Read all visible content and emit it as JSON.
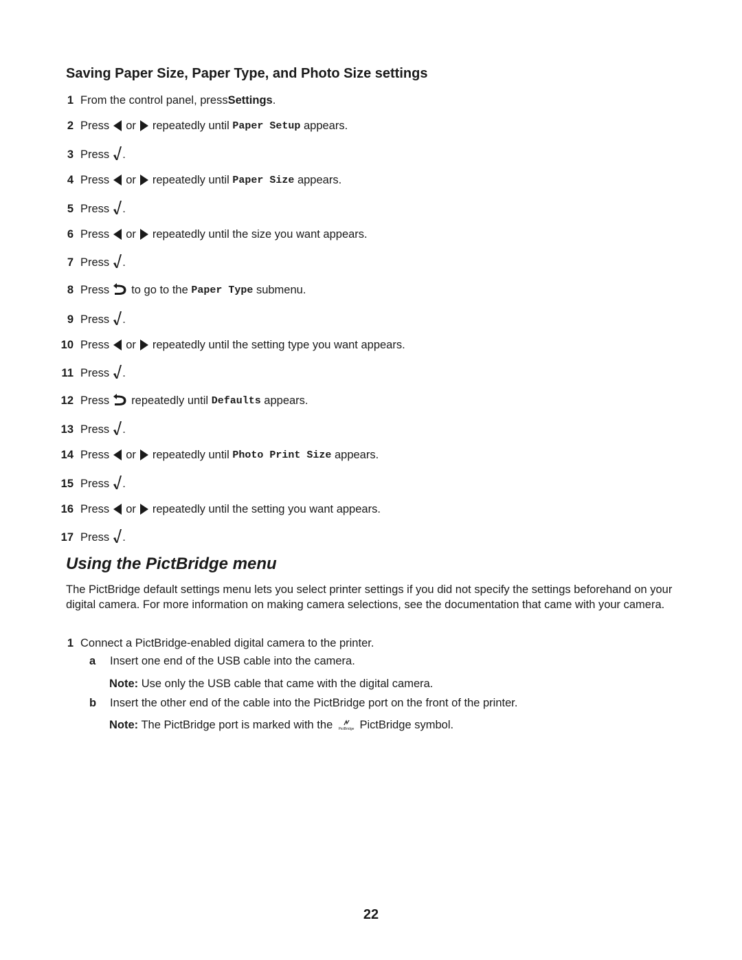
{
  "section": {
    "title": "Saving Paper Size, Paper Type, and Photo Size settings",
    "steps": [
      {
        "num": "1",
        "pre": "From the control panel, press ",
        "bold": "Settings",
        "post": "."
      },
      {
        "num": "2",
        "pre": "Press",
        "or": "or",
        "mid": "repeatedly until ",
        "code": "Paper Setup",
        "post": " appears."
      },
      {
        "num": "3",
        "pre": "Press",
        "post": "."
      },
      {
        "num": "4",
        "pre": "Press",
        "or": "or",
        "mid": "repeatedly until ",
        "code": "Paper Size",
        "post": " appears."
      },
      {
        "num": "5",
        "pre": "Press",
        "post": "."
      },
      {
        "num": "6",
        "pre": "Press",
        "or": "or",
        "mid": "repeatedly until the size you want appears."
      },
      {
        "num": "7",
        "pre": "Press",
        "post": "."
      },
      {
        "num": "8",
        "pre": "Press",
        "mid": "to go to the ",
        "code": "Paper Type",
        "post": " submenu."
      },
      {
        "num": "9",
        "pre": "Press",
        "post": "."
      },
      {
        "num": "10",
        "pre": "Press",
        "or": "or",
        "mid": "repeatedly until the setting type you want appears."
      },
      {
        "num": "11",
        "pre": "Press",
        "post": "."
      },
      {
        "num": "12",
        "pre": "Press",
        "mid": "repeatedly until ",
        "code": "Defaults",
        "post": " appears."
      },
      {
        "num": "13",
        "pre": "Press",
        "post": "."
      },
      {
        "num": "14",
        "pre": "Press",
        "or": "or",
        "mid": "repeatedly until ",
        "code": "Photo Print Size",
        "post": " appears."
      },
      {
        "num": "15",
        "pre": "Press",
        "post": "."
      },
      {
        "num": "16",
        "pre": "Press",
        "or": "or",
        "mid": "repeatedly until the setting you want appears."
      },
      {
        "num": "17",
        "pre": "Press",
        "post": "."
      }
    ]
  },
  "pictbridge": {
    "title": "Using the PictBridge menu",
    "intro": "The PictBridge default settings menu lets you select printer settings if you did not specify the settings beforehand on your digital camera. For more information on making camera selections, see the documentation that came with your camera.",
    "step1": {
      "num": "1",
      "text": "Connect a PictBridge-enabled digital camera to the printer."
    },
    "sub_a": {
      "letter": "a",
      "text": "Insert one end of the USB cable into the camera."
    },
    "note_a": {
      "label": "Note:",
      "text": " Use only the USB cable that came with the digital camera."
    },
    "sub_b": {
      "letter": "b",
      "text": "Insert the other end of the cable into the PictBridge port on the front of the printer."
    },
    "note_b": {
      "label": "Note:",
      "pre": " The PictBridge port is marked with the",
      "post": "PictBridge symbol.",
      "icon_label": "PictBridge"
    }
  },
  "page_number": "22"
}
